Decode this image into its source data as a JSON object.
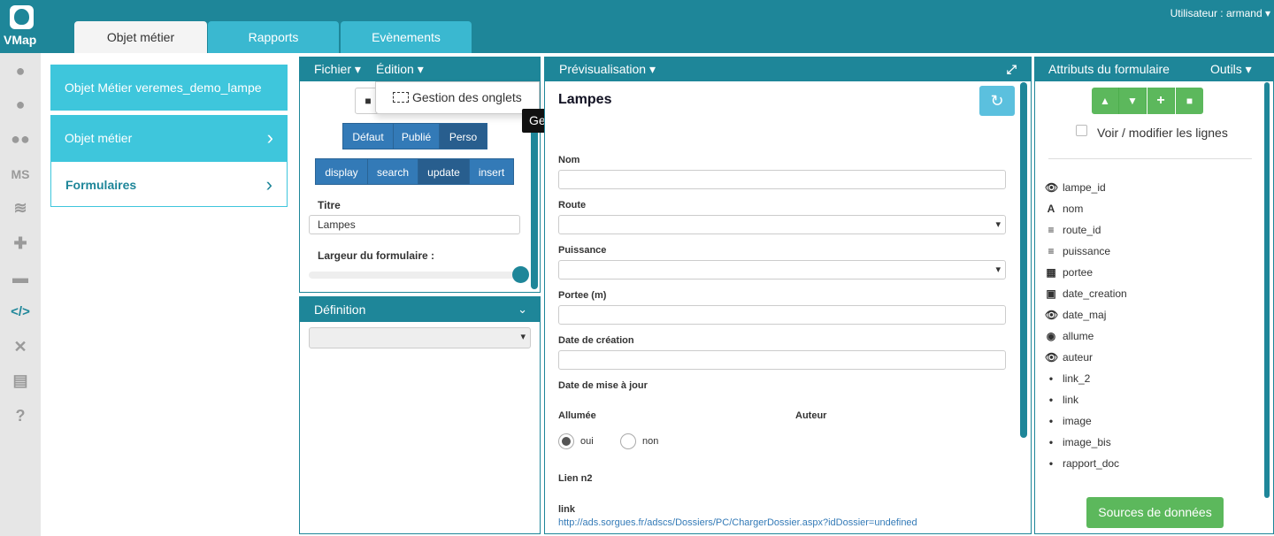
{
  "app": {
    "name": "VMap",
    "user": "Utilisateur : armand ▾"
  },
  "tabs": [
    {
      "label": "Objet métier",
      "active": true
    },
    {
      "label": "Rapports",
      "active": false
    },
    {
      "label": "Evènements",
      "active": false
    }
  ],
  "sidebar_icons": [
    "globe-icon",
    "user-icon",
    "users-icon",
    "ms-icon",
    "layers-icon",
    "puzzle-icon",
    "printer-icon",
    "code-icon",
    "tools-icon",
    "document-icon",
    "help-icon"
  ],
  "left_menu": {
    "title": "Objet Métier veremes_demo_lampe",
    "item1": "Objet métier",
    "item2": "Formulaires"
  },
  "editor": {
    "fichier": "Fichier ▾",
    "edition": "Édition ▾",
    "dropdown_item": "Gestion des onglets",
    "tooltip": "Gestion des onglets",
    "mode_buttons": [
      "Défaut",
      "Publié",
      "Perso"
    ],
    "form_buttons": [
      "display",
      "search",
      "update",
      "insert"
    ],
    "titre_label": "Titre",
    "titre_value": "Lampes",
    "largeur_label": "Largeur du formulaire :",
    "definition": "Définition"
  },
  "preview": {
    "header": "Prévisualisation ▾",
    "title": "Lampes",
    "nom": "Nom",
    "route": "Route",
    "puissance": "Puissance",
    "portee": "Portee (m)",
    "date_creation": "Date de création",
    "date_maj": "Date de mise à jour",
    "allumee": "Allumée",
    "auteur": "Auteur",
    "oui": "oui",
    "non": "non",
    "lien": "Lien n2",
    "link": "link",
    "url": "http://ads.sorgues.fr/adscs/Dossiers/PC/ChargerDossier.aspx?idDossier=undefined"
  },
  "attributes": {
    "header": "Attributs du formulaire",
    "outils": "Outils ▾",
    "voir": "Voir / modifier les lignes",
    "items": [
      {
        "icon": "👁",
        "name": "lampe_id"
      },
      {
        "icon": "A",
        "name": "nom"
      },
      {
        "icon": "≡",
        "name": "route_id"
      },
      {
        "icon": "≡",
        "name": "puissance"
      },
      {
        "icon": "▦",
        "name": "portee"
      },
      {
        "icon": "▣",
        "name": "date_creation"
      },
      {
        "icon": "👁",
        "name": "date_maj"
      },
      {
        "icon": "◉",
        "name": "allume"
      },
      {
        "icon": "👁",
        "name": "auteur"
      },
      {
        "icon": "•",
        "name": "link_2"
      },
      {
        "icon": "•",
        "name": "link"
      },
      {
        "icon": "•",
        "name": "image"
      },
      {
        "icon": "•",
        "name": "image_bis"
      },
      {
        "icon": "•",
        "name": "rapport_doc"
      }
    ],
    "sources": "Sources de données"
  }
}
